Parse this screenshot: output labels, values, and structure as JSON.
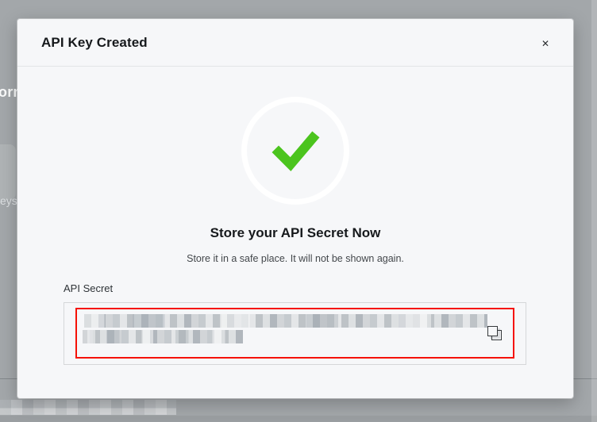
{
  "background": {
    "clipped_text_top": "orn",
    "clipped_text_middle": "eys"
  },
  "modal": {
    "title": "API Key Created",
    "heading": "Store your API Secret Now",
    "subtext": "Store it in a safe place. It will not be shown again.",
    "field_label": "API Secret",
    "secret_value_redacted": true
  },
  "icons": {
    "close_glyph": "✕"
  },
  "colors": {
    "overlay_gray": "#a3a7aa",
    "modal_bg": "#f6f7f9",
    "success_green": "#4bc41e",
    "highlight_red": "#f51104",
    "border_gray": "#d5d7d9",
    "divider": "#e3e5e7",
    "text_dark": "#16191c",
    "text_mid": "#43474b"
  }
}
